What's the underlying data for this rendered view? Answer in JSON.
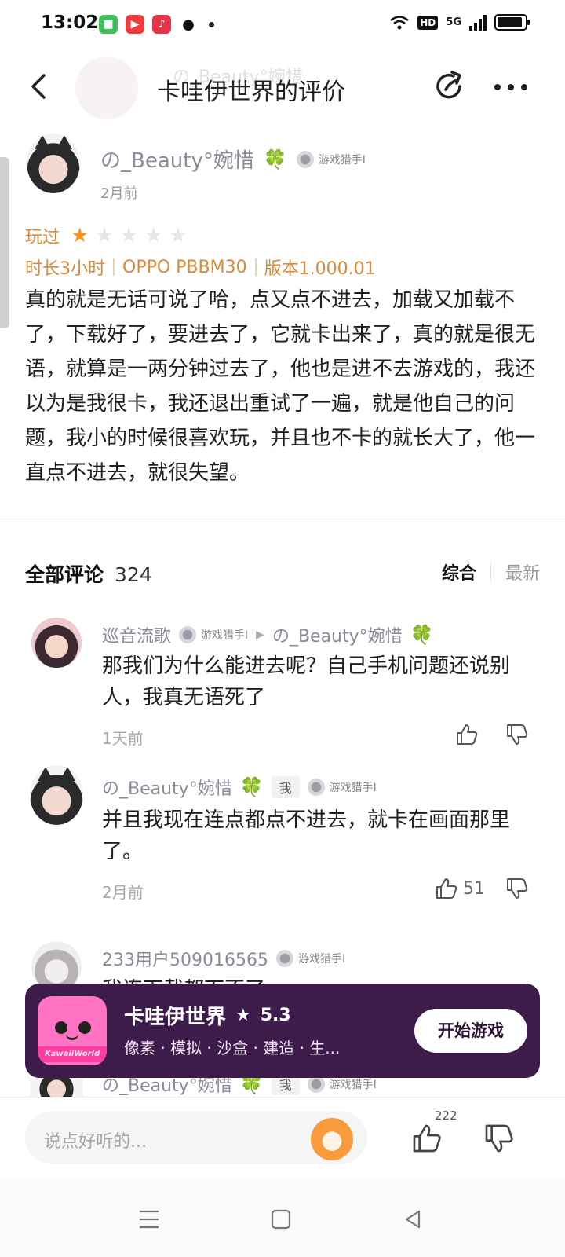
{
  "status_bar": {
    "time": "13:02",
    "network": "5G",
    "hd": "HD",
    "battery_level": 0.9
  },
  "header": {
    "title": "卡哇伊世界的评价",
    "ghost_name": "の_Beauty°婉惜"
  },
  "review": {
    "author": "の_Beauty°婉惜",
    "badge": "游戏猎手I",
    "time": "2月前",
    "played_label": "玩过",
    "rating": 1,
    "max_rating": 5,
    "duration": "时长3小时",
    "device": "OPPO PBBM30",
    "version": "版本1.000.01",
    "body": "真的就是无话可说了哈，点又点不进去，加载又加载不了，下载好了，要进去了，它就卡出来了，真的就是很无语，就算是一两分钟过去了，他也是进不去游戏的，我还以为是我很卡，我还退出重试了一遍，就是他自己的问题，我小的时候很喜欢玩，并且也不卡的就长大了，他一直点不进去，就很失望。"
  },
  "comments_header": {
    "title": "全部评论",
    "count": "324",
    "sort_active": "综合",
    "sort_other": "最新"
  },
  "comments": [
    {
      "author": "巡音流歌",
      "badge": "游戏猎手I",
      "reply_to": "の_Beauty°婉惜",
      "text": "那我们为什么能进去呢？自己手机问题还说别人，我真无语死了",
      "time": "1天前"
    },
    {
      "author": "の_Beauty°婉惜",
      "me_tag": "我",
      "badge": "游戏猎手I",
      "text": "并且我现在连点都点不进去，就卡在画面那里了。",
      "time": "2月前",
      "likes": "51"
    },
    {
      "author": "233用户509016565",
      "badge": "游戏猎手I",
      "text": "我连下载都下不了"
    },
    {
      "author": "の_Beauty°婉惜",
      "me_tag": "我",
      "badge": "游戏猎手I"
    }
  ],
  "game_card": {
    "name": "卡哇伊世界",
    "rating": "5.3",
    "tags": "像素 · 模拟 · 沙盒 · 建造 · 生...",
    "icon_text": "KawaiiWorld",
    "button": "开始游戏",
    "background": "#3d1c4b"
  },
  "bottom_bar": {
    "placeholder": "说点好听的...",
    "like_count": "222"
  },
  "colors": {
    "accent_orange": "#d98a3a",
    "star": "#f7941d",
    "clover": "#3bb54a"
  }
}
